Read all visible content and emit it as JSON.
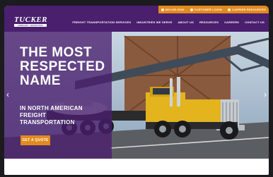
{
  "header": {
    "logo": {
      "name": "TUCKER",
      "tagline": "FREIGHT LOGISTICS"
    },
    "utility": [
      {
        "icon": "phone-icon",
        "label": "800.000.0000"
      },
      {
        "icon": "user-icon",
        "label": "CUSTOMER LOGIN"
      },
      {
        "icon": "truck-icon",
        "label": "CARRIER RESOURCES"
      }
    ],
    "nav": [
      "FREIGHT TRANSPORTATION SERVICES",
      "INDUSTRIES WE SERVE",
      "ABOUT US",
      "RESOURCES",
      "CAREERS",
      "CONTACT US"
    ]
  },
  "hero": {
    "headline": "THE MOST\nRESPECTED\nNAME",
    "subhead": "IN NORTH AMERICAN\nFREIGHT\nTRANSPORTATION",
    "cta": "GET A QUOTE",
    "prev_arrow": "‹",
    "next_arrow": "›"
  },
  "colors": {
    "brand_purple": "#4a1f6e",
    "accent_orange": "#e38a1d",
    "truck_yellow": "#e3b41e"
  }
}
